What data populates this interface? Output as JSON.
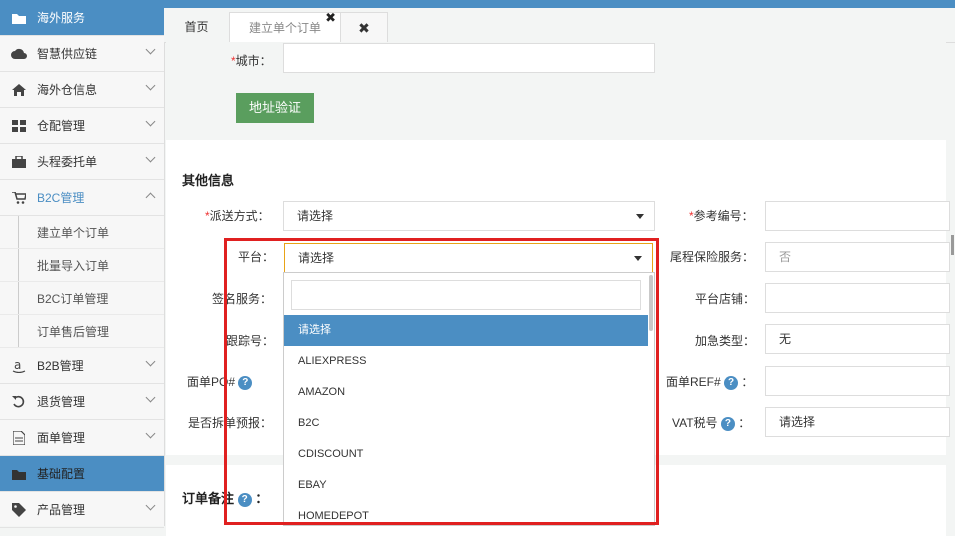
{
  "sidebar": {
    "items": [
      {
        "label": "海外服务",
        "icon": "folder-icon",
        "type": "header"
      },
      {
        "label": "智慧供应链",
        "icon": "cloud-icon",
        "type": "item"
      },
      {
        "label": "海外仓信息",
        "icon": "home-icon",
        "type": "item"
      },
      {
        "label": "仓配管理",
        "icon": "grid-icon",
        "type": "item"
      },
      {
        "label": "头程委托单",
        "icon": "briefcase-icon",
        "type": "item"
      },
      {
        "label": "B2C管理",
        "icon": "cart-icon",
        "type": "expanded"
      }
    ],
    "subitems": [
      "建立单个订单",
      "批量导入订单",
      "B2C订单管理",
      "订单售后管理"
    ],
    "items2": [
      {
        "label": "B2B管理",
        "icon": "amazon-icon",
        "type": "item"
      },
      {
        "label": "退货管理",
        "icon": "return-icon",
        "type": "item"
      },
      {
        "label": "面单管理",
        "icon": "document-icon",
        "type": "item"
      },
      {
        "label": "基础配置",
        "icon": "folder-icon",
        "type": "header"
      },
      {
        "label": "产品管理",
        "icon": "tag-icon",
        "type": "item"
      }
    ]
  },
  "tabs": {
    "home": "首页",
    "active": "建立单个订单",
    "close_all": "✖"
  },
  "address": {
    "city_label": "城市：",
    "verify_button": "地址验证"
  },
  "other_info": {
    "title": "其他信息",
    "delivery_label": "派送方式：",
    "delivery_value": "请选择",
    "ref_label": "参考编号：",
    "platform_label": "平台：",
    "platform_value": "请选择",
    "insurance_label": "尾程保险服务：",
    "insurance_value": "否",
    "sign_label": "签名服务：",
    "shop_label": "平台店铺：",
    "tracking_label": "跟踪号：",
    "urgent_label": "加急类型：",
    "urgent_value": "无",
    "po_label": "面单PO#",
    "ref2_label": "面单REF#",
    "split_label": "是否拆单预报：",
    "vat_label": "VAT税号",
    "vat_value": "请选择",
    "colon": "："
  },
  "remarks": {
    "title": "订单备注",
    "colon": "："
  },
  "dropdown": {
    "options": [
      "请选择",
      "ALIEXPRESS",
      "AMAZON",
      "B2C",
      "CDISCOUNT",
      "EBAY",
      "HOMEDEPOT"
    ],
    "selected_index": 0
  },
  "colors": {
    "accent": "#4b8ec3",
    "button_green": "#5a9e5e",
    "highlight_border": "#e02020"
  }
}
